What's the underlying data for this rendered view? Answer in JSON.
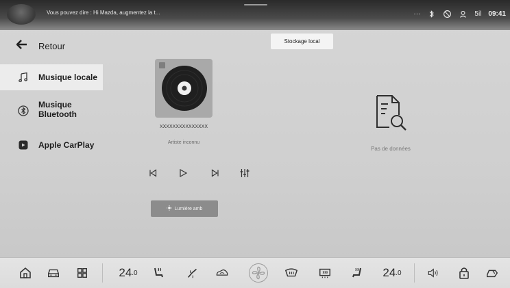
{
  "statusbar": {
    "voice_hint": "Vous pouvez dire : Hi Mazda, augmentez la t...",
    "dots": "···",
    "signal_text": "5il",
    "clock": "09:41"
  },
  "sidebar": {
    "back_label": "Retour",
    "items": [
      {
        "label": "Musique locale",
        "icon": "music-note-icon",
        "active": true
      },
      {
        "label": "Musique\nBluetooth",
        "icon": "bluetooth-icon",
        "active": false
      },
      {
        "label": "Apple CarPlay",
        "icon": "carplay-icon",
        "active": false
      }
    ]
  },
  "tabs": {
    "local_storage": "Stockage local"
  },
  "player": {
    "track_title": "XXXXXXXXXXXXXXX",
    "artist": "Artiste inconnu",
    "ambient_button": "Lumière amb"
  },
  "empty_state": {
    "text": "Pas de données"
  },
  "dock": {
    "temp_left_value": "24",
    "temp_left_decimal": ".0",
    "temp_right_value": "24",
    "temp_right_decimal": ".0"
  },
  "colors": {
    "statusbar_bg": "#3a3a3a",
    "screen_bg": "#d0d0d0",
    "active_item_bg": "#ececec",
    "ambient_button_bg": "#8c8c8c"
  }
}
